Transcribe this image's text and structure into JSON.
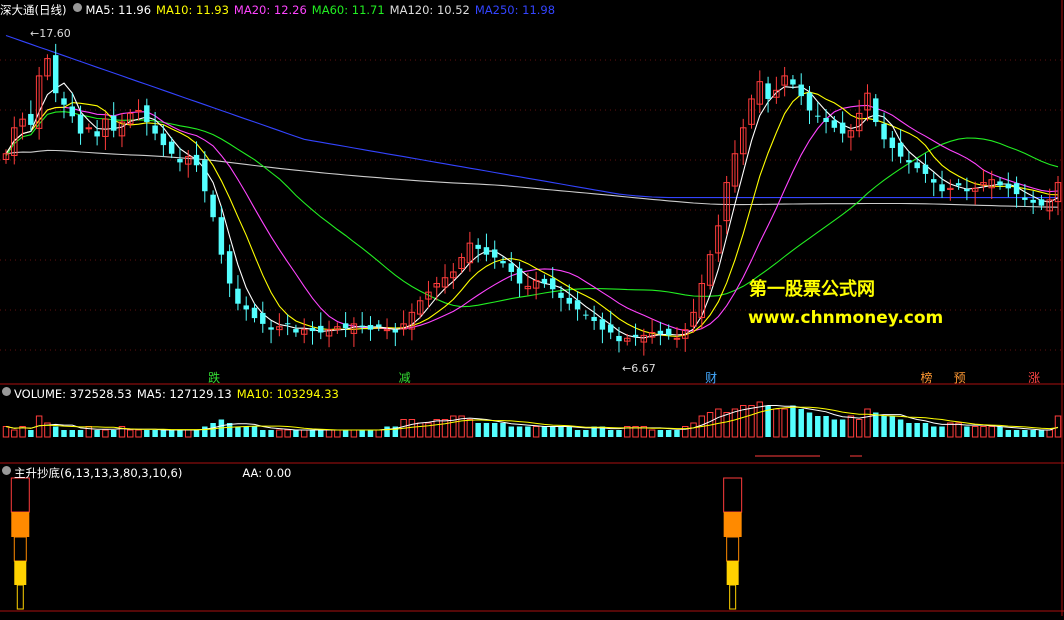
{
  "header": {
    "title": "深大通(日线)",
    "ma": [
      {
        "label": "MA5: 11.96",
        "color": "#ffffff"
      },
      {
        "label": "MA10: 11.93",
        "color": "#ffff00"
      },
      {
        "label": "MA20: 12.26",
        "color": "#ff44ff"
      },
      {
        "label": "MA60: 11.71",
        "color": "#22ee22"
      },
      {
        "label": "MA120: 10.52",
        "color": "#dddddd"
      },
      {
        "label": "MA250: 11.98",
        "color": "#3344ff"
      }
    ]
  },
  "volume_header": {
    "volume": "VOLUME: 372528.53",
    "ma5": "MA5: 127129.13",
    "ma10": "MA10: 103294.33"
  },
  "indicator_header": {
    "name": "主升抄底(6,13,13,3,80,3,10,6)",
    "aa": "AA: 0.00"
  },
  "watermark": {
    "line1": "第一股票公式网",
    "line2": "www.chnmoney.com"
  },
  "chart_data": {
    "type": "candlestick",
    "title": "深大通(日线)",
    "price_annotations": {
      "high": "17.60",
      "low": "6.67"
    },
    "event_tags": [
      {
        "text": "跌",
        "idx": 25,
        "color": "#33dd33"
      },
      {
        "text": "减",
        "idx": 48,
        "color": "#33dd33"
      },
      {
        "text": "财",
        "idx": 85,
        "color": "#44aaff"
      },
      {
        "text": "榜",
        "idx": 111,
        "color": "#ff9933"
      },
      {
        "text": "预",
        "idx": 115,
        "color": "#ff9933"
      },
      {
        "text": "涨",
        "idx": 124,
        "color": "#ff4444"
      }
    ],
    "closes": [
      13.5,
      14.4,
      14.7,
      14.5,
      16.2,
      16.8,
      15.6,
      15.2,
      14.8,
      14.2,
      14.4,
      14.1,
      14.7,
      14.3,
      14.6,
      14.9,
      15.0,
      14.6,
      14.2,
      13.8,
      13.5,
      13.2,
      13.4,
      13.1,
      12.2,
      11.3,
      10.0,
      9.0,
      8.3,
      8.1,
      7.8,
      7.6,
      7.4,
      7.5,
      7.6,
      7.3,
      7.4,
      7.35,
      7.3,
      7.4,
      7.5,
      7.45,
      7.6,
      7.5,
      7.4,
      7.5,
      7.4,
      7.3,
      7.6,
      8.0,
      8.4,
      8.7,
      9.0,
      9.2,
      9.4,
      9.9,
      10.4,
      10.2,
      10.0,
      9.9,
      9.7,
      9.4,
      9.0,
      8.9,
      9.1,
      9.0,
      8.8,
      8.5,
      8.3,
      8.1,
      7.9,
      7.7,
      7.4,
      7.3,
      7.0,
      7.1,
      7.15,
      7.2,
      7.3,
      7.25,
      7.2,
      7.1,
      7.4,
      8.0,
      9.0,
      10.0,
      11.0,
      12.5,
      13.5,
      14.4,
      15.4,
      16.0,
      15.4,
      15.7,
      16.2,
      15.9,
      15.5,
      15.0,
      14.8,
      14.6,
      14.4,
      14.2,
      14.3,
      14.9,
      15.6,
      14.6,
      14.0,
      13.7,
      13.4,
      13.2,
      13.0,
      12.8,
      12.5,
      12.2,
      12.3,
      12.4,
      12.2,
      12.3,
      12.5,
      12.6,
      12.4,
      12.3,
      12.1,
      11.9,
      11.8,
      11.7,
      11.9,
      12.5
    ],
    "ma_lines": {
      "MA250": [
        17.6,
        17.5,
        17.4,
        17.3,
        17.2,
        17.1,
        17.0,
        16.9,
        16.8,
        16.7,
        16.6,
        16.5,
        16.4,
        16.3,
        16.2,
        16.1,
        16.0,
        15.9,
        15.8,
        15.7,
        15.6,
        15.5,
        15.4,
        15.3,
        15.2,
        15.1,
        15.0,
        14.9,
        14.8,
        14.7,
        14.6,
        14.5,
        14.4,
        14.3,
        14.2,
        14.1,
        14.0,
        13.95,
        13.9,
        13.85,
        13.8,
        13.75,
        13.7,
        13.65,
        13.6,
        13.55,
        13.5,
        13.45,
        13.4,
        13.35,
        13.3,
        13.25,
        13.2,
        13.15,
        13.1,
        13.05,
        13.0,
        12.95,
        12.9,
        12.85,
        12.8,
        12.75,
        12.7,
        12.65,
        12.6,
        12.55,
        12.5,
        12.45,
        12.4,
        12.35,
        12.3,
        12.25,
        12.2,
        12.15,
        12.1,
        12.07,
        12.04,
        12.02,
        12.0,
        11.99,
        11.98,
        11.98,
        11.98,
        11.98,
        11.98,
        11.98,
        11.98,
        11.98,
        11.98,
        11.98,
        11.98,
        11.98,
        11.98,
        11.98,
        11.98,
        11.98,
        11.98,
        11.98,
        11.98,
        11.98,
        11.98,
        11.98,
        11.98,
        11.98,
        11.98,
        11.98,
        11.98,
        11.98,
        11.98,
        11.98,
        11.98,
        11.98,
        11.98,
        11.98,
        11.98,
        11.98,
        11.98,
        11.98,
        11.98,
        11.98,
        11.98,
        11.98,
        11.98,
        11.98,
        11.98,
        11.98,
        11.98,
        11.98
      ]
    },
    "volume": [
      3,
      2,
      3,
      2,
      6,
      4,
      3,
      2,
      2,
      2,
      3,
      2,
      2,
      2,
      3,
      2,
      2,
      2,
      2,
      2,
      2,
      2,
      2,
      2,
      3,
      4,
      5,
      4,
      3,
      3,
      3,
      2,
      2,
      2,
      2,
      2,
      2,
      2,
      2,
      2,
      2,
      2,
      2,
      2,
      2,
      2,
      3,
      3,
      5,
      5,
      4,
      4,
      5,
      5,
      6,
      6,
      5,
      4,
      4,
      4,
      4,
      3,
      3,
      3,
      3,
      3,
      3,
      3,
      3,
      2,
      2,
      3,
      3,
      2,
      2,
      3,
      3,
      3,
      2,
      2,
      2,
      2,
      3,
      4,
      6,
      7,
      8,
      7,
      8,
      9,
      9,
      10,
      9,
      8,
      8,
      9,
      8,
      7,
      6,
      6,
      5,
      5,
      6,
      5,
      8,
      7,
      6,
      6,
      5,
      4,
      4,
      4,
      3,
      3,
      4,
      4,
      3,
      3,
      3,
      3,
      3,
      2,
      2,
      2,
      2,
      2,
      2,
      6
    ],
    "indicator_spikes": [
      1,
      87
    ],
    "ylim": [
      6.0,
      18.0
    ]
  }
}
